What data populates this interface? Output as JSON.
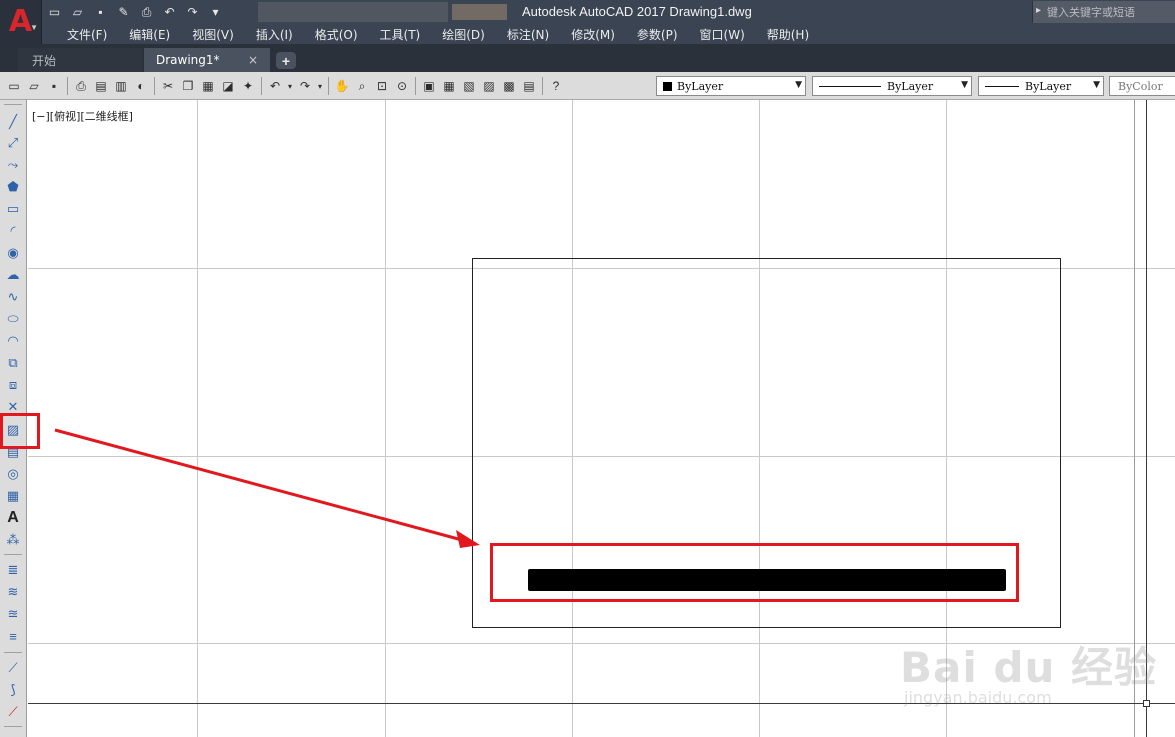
{
  "window": {
    "title": "Autodesk AutoCAD 2017    Drawing1.dwg",
    "app_logo": "A"
  },
  "search": {
    "placeholder": "键入关键字或短语"
  },
  "menu": [
    "文件(F)",
    "编辑(E)",
    "视图(V)",
    "插入(I)",
    "格式(O)",
    "工具(T)",
    "绘图(D)",
    "标注(N)",
    "修改(M)",
    "参数(P)",
    "窗口(W)",
    "帮助(H)"
  ],
  "tabs": {
    "start": "开始",
    "drawing": "Drawing1*",
    "close_glyph": "×",
    "add_glyph": "+"
  },
  "properties": {
    "color": "ByLayer",
    "linetype": "ByLayer",
    "lineweight": "ByLayer",
    "plotstyle": "ByColor"
  },
  "viewport": {
    "label": "[−][俯视][二维线框]"
  },
  "left_toolbar_icons": [
    "line-icon",
    "construction-line-icon",
    "polyline-icon",
    "polygon-icon",
    "rectangle-icon",
    "arc-icon",
    "circle-icon",
    "revision-cloud-icon",
    "spline-icon",
    "ellipse-icon",
    "ellipse-arc-icon",
    "insert-block-icon",
    "make-block-icon",
    "point-icon",
    "hatch-icon",
    "gradient-icon",
    "region-icon",
    "table-icon",
    "multiline-text-icon",
    "add-selected-icon"
  ],
  "highlight_color": "#e1191f",
  "watermark": {
    "main": "Bai du 经验",
    "sub": "jingyan.baidu.com"
  }
}
